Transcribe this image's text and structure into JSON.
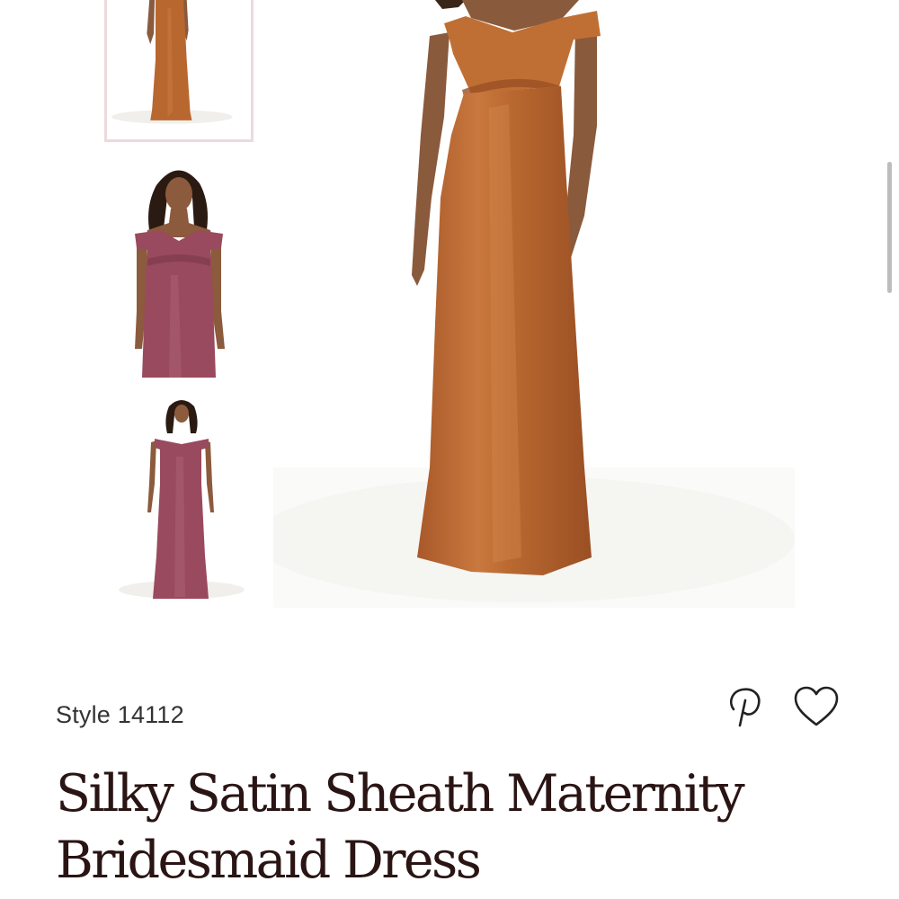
{
  "gallery": {
    "thumbnails": [
      {
        "color_name": "rust-orange",
        "dress_color": "#b8672f",
        "selected": true
      },
      {
        "color_name": "mauve",
        "dress_color": "#9a4a5e",
        "selected": false
      },
      {
        "color_name": "mauve",
        "dress_color": "#9a4a5e",
        "selected": false
      }
    ],
    "main_image": {
      "color_name": "rust-orange",
      "dress_color": "#b8682f"
    }
  },
  "product": {
    "style_label": "Style 14112",
    "title_line1": "Silky Satin Sheath Maternity",
    "title_line2": "Bridesmaid Dress"
  },
  "actions": {
    "pinterest_icon": "pinterest-icon",
    "wishlist_icon": "heart-icon"
  },
  "colors": {
    "title_text": "#2a1414",
    "selected_thumb_border": "#eed9dd"
  }
}
